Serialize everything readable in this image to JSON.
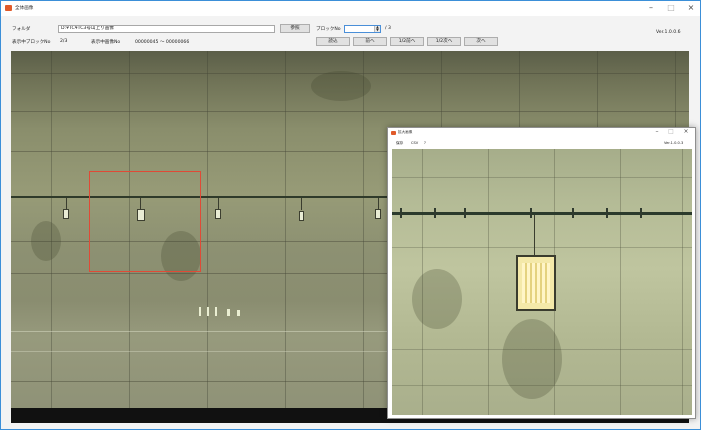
{
  "window": {
    "title": "全体画像",
    "version": "Ver.1.0.0.6"
  },
  "controls": {
    "folder_label": "フォルダ",
    "folder_value": "D:¥TC¥TC3号山上り画像",
    "browse_button": "参照",
    "block_label": "ブロックNo",
    "block_value": "",
    "block_total": "/ 3",
    "display_block_label": "表示中ブロックNo",
    "display_block_value": "2/3",
    "display_image_label": "表示中画像No",
    "display_image_value": "00000045 〜 00000066",
    "buttons": [
      "読込",
      "前へ",
      "1/2前へ",
      "1/2次へ",
      "次へ"
    ]
  },
  "popup": {
    "title": "拡大画像",
    "menu": [
      "保存",
      "CSV",
      "?"
    ],
    "version": "Ver.1.0.0.3"
  },
  "colors": {
    "accent": "#3b8fd8",
    "roi": "#e04a36"
  },
  "icons": {
    "app": "app-icon",
    "minimize": "minimize-icon",
    "maximize": "maximize-icon",
    "close": "close-icon"
  }
}
